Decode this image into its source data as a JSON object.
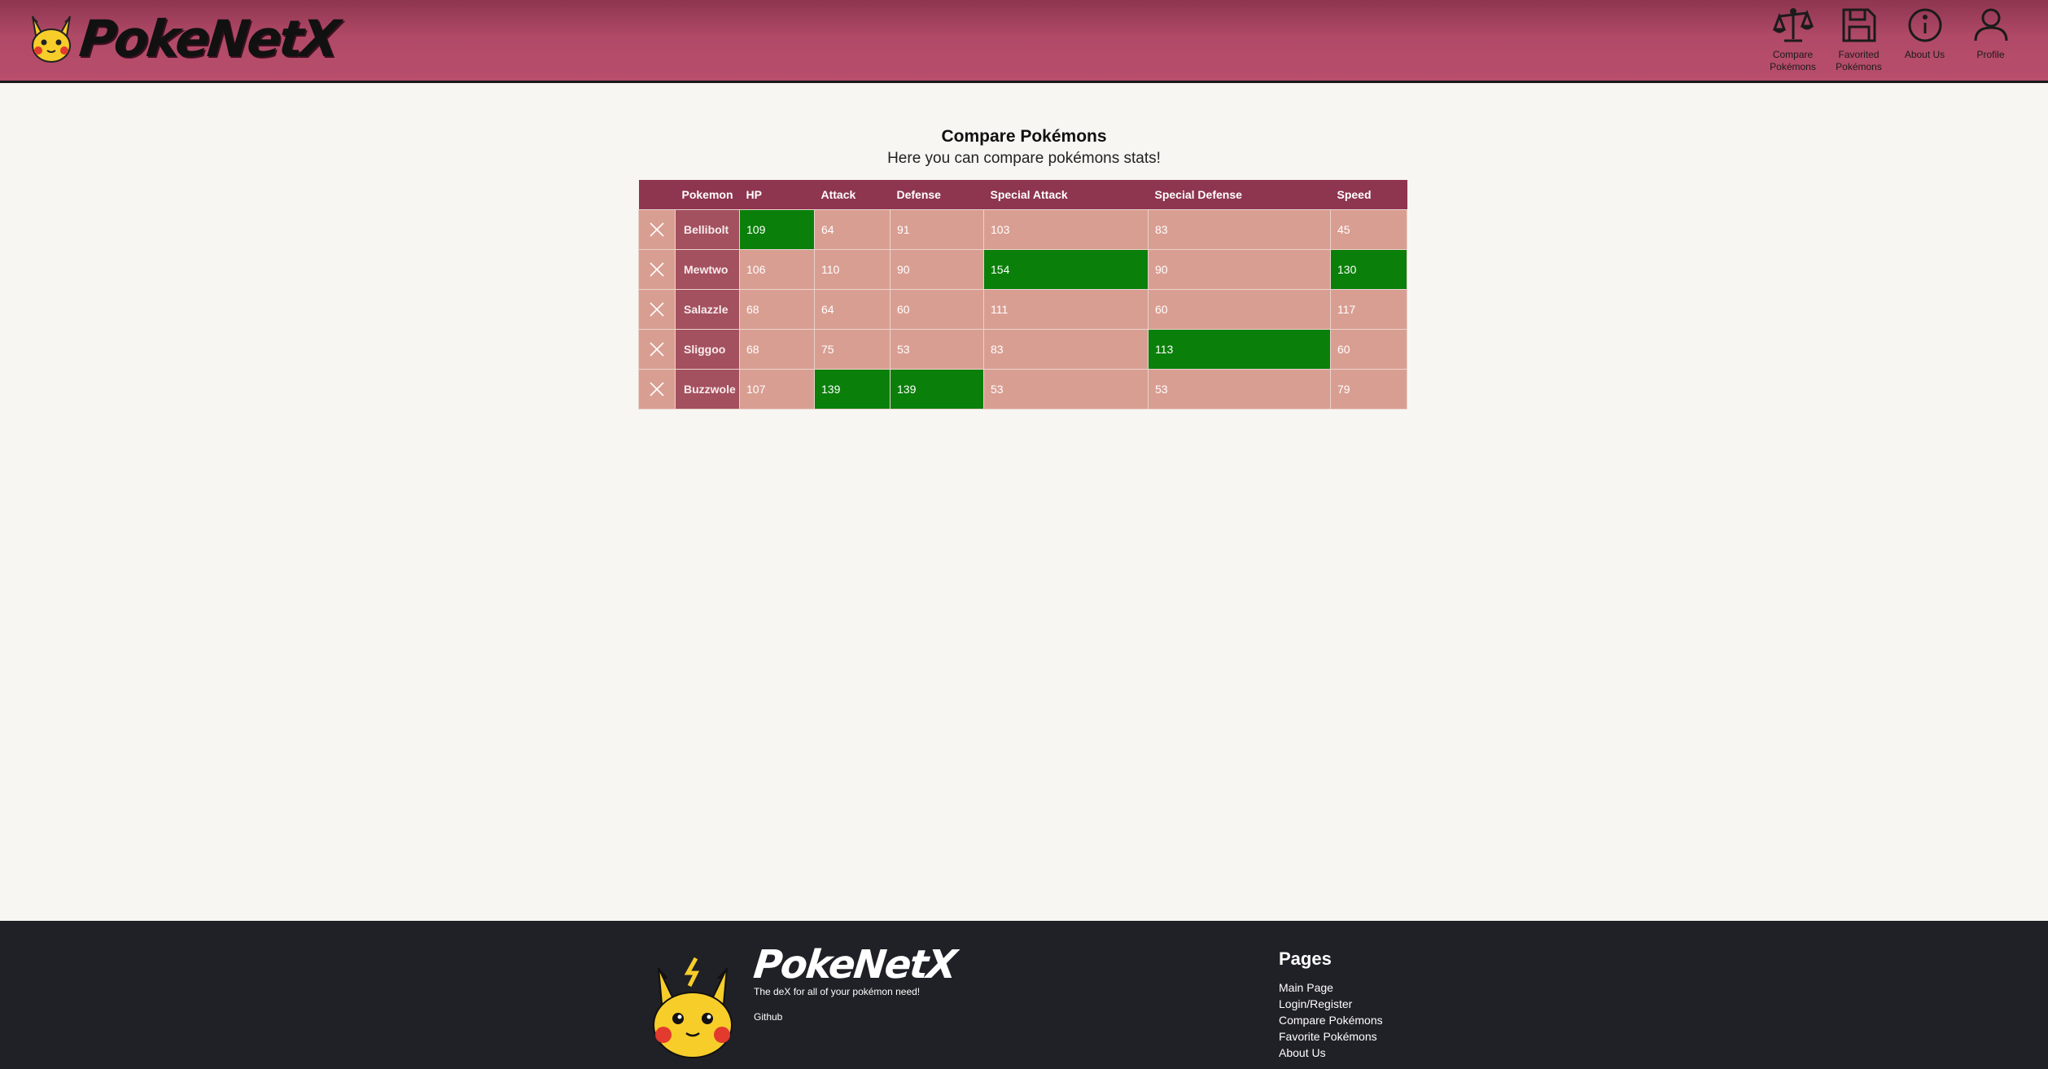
{
  "header": {
    "logo_text": "PokeNetX",
    "nav": [
      {
        "label": "Compare Pokémons",
        "icon": "scale-icon"
      },
      {
        "label": "Favorited Pokémons",
        "icon": "floppy-disk-icon"
      },
      {
        "label": "About Us",
        "icon": "info-icon"
      },
      {
        "label": "Profile",
        "icon": "user-icon"
      }
    ]
  },
  "main": {
    "title": "Compare Pokémons",
    "subtitle": "Here you can compare pokémons stats!",
    "table": {
      "headers": [
        "",
        "Pokemon",
        "HP",
        "Attack",
        "Defense",
        "Special Attack",
        "Special Defense",
        "Speed"
      ],
      "rows": [
        {
          "name": "Bellibolt",
          "stats": [
            "109",
            "64",
            "91",
            "103",
            "83",
            "45"
          ],
          "best": [
            0
          ]
        },
        {
          "name": "Mewtwo",
          "stats": [
            "106",
            "110",
            "90",
            "154",
            "90",
            "130"
          ],
          "best": [
            3,
            5
          ]
        },
        {
          "name": "Salazzle",
          "stats": [
            "68",
            "64",
            "60",
            "111",
            "60",
            "117"
          ],
          "best": []
        },
        {
          "name": "Sliggoo",
          "stats": [
            "68",
            "75",
            "53",
            "83",
            "113",
            "60"
          ],
          "best": [
            4
          ]
        },
        {
          "name": "Buzzwole",
          "stats": [
            "107",
            "139",
            "139",
            "53",
            "53",
            "79"
          ],
          "best": [
            1,
            2
          ]
        }
      ]
    }
  },
  "footer": {
    "logo_text": "PokeNetX",
    "tagline": "The deX for all of your pokémon need!",
    "github": "Github",
    "pages_title": "Pages",
    "links": [
      "Main Page",
      "Login/Register",
      "Compare Pokémons",
      "Favorite Pokémons",
      "About Us"
    ]
  },
  "colors": {
    "header_bg": "#b84d6c",
    "table_header_bg": "#8e3550",
    "cell_bg": "#d99e92",
    "name_cell_bg": "#a3505f",
    "best_stat_bg": "#0a800a",
    "footer_bg": "#202027"
  }
}
